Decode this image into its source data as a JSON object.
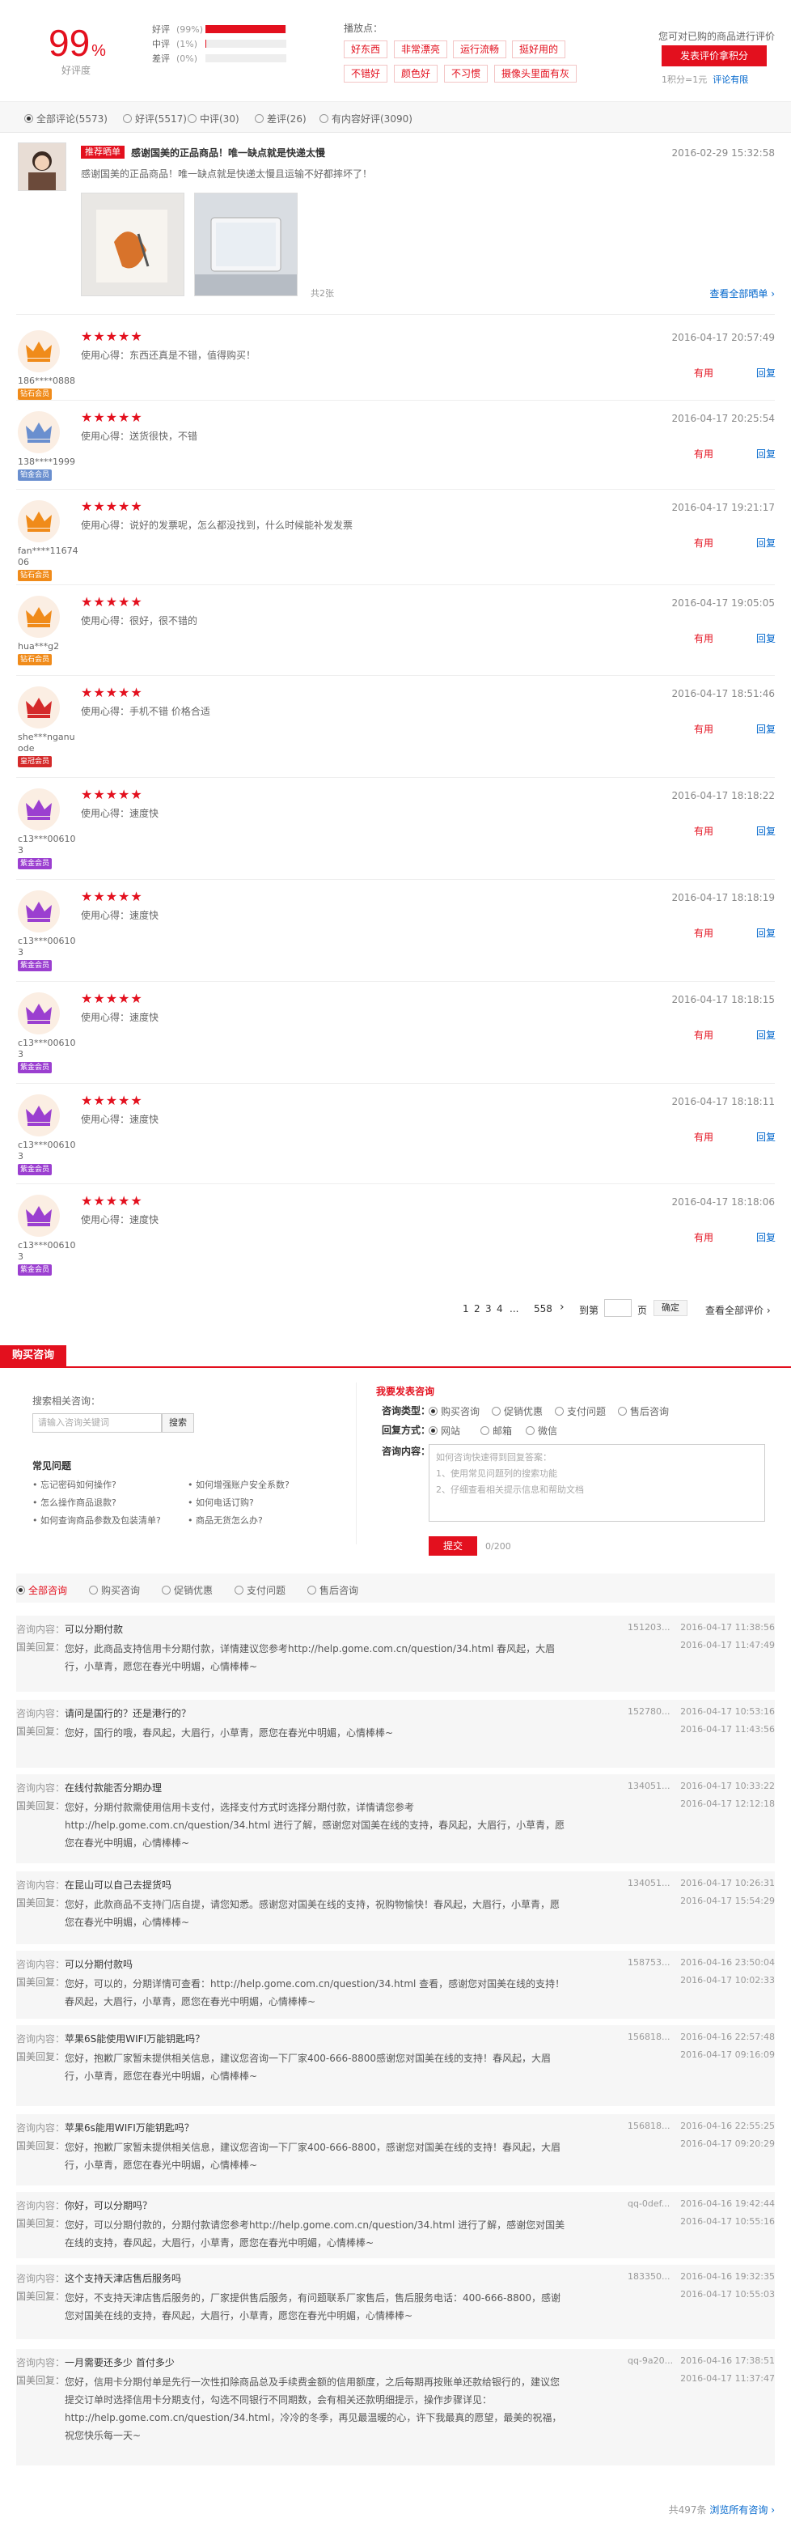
{
  "summary": {
    "good_rate": "99",
    "good_rate_unit": "%",
    "good_rate_label": "好评度",
    "ratings": [
      {
        "label": "好评",
        "percent_text": "(99%)",
        "value": 0.99
      },
      {
        "label": "中评",
        "percent_text": "(1%)",
        "value": 0.01
      },
      {
        "label": "差评",
        "percent_text": "(0%)",
        "value": 0.0
      }
    ],
    "tags_title": "播放点：",
    "tags": [
      "好东西",
      "非常漂亮",
      "运行流畅",
      "挺好用的",
      "不错好",
      "颜色好",
      "不习惯",
      "摄像头里面有灰"
    ],
    "right_text": "您可对已购的商品进行评价",
    "review_button": "发表评价拿积分",
    "points_note": "1积分=1元",
    "points_link": "评论有限"
  },
  "filters": [
    {
      "label": "全部评论(5573)",
      "checked": true
    },
    {
      "label": "好评(5517)",
      "checked": false
    },
    {
      "label": "中评(30)",
      "checked": false
    },
    {
      "label": "差评(26)",
      "checked": false
    },
    {
      "label": "有内容好评(3090)",
      "checked": false
    }
  ],
  "featured": {
    "badge": "推荐晒单",
    "title": "感谢国美的正品商品！唯一缺点就是快递太慢",
    "text": "感谢国美的正品商品！唯一缺点就是快递太慢且运输不好都摔坏了！",
    "date": "2016-02-29 15:32:58",
    "photo_count": "共2张",
    "view_all": "查看全部晒单 ›"
  },
  "reviews": [
    {
      "user": "186****0888",
      "level": "钻石会员",
      "stars": "★★★★★",
      "text": "使用心得：东西还真是不错，值得购买！",
      "date": "2016-04-17 20:57:49"
    },
    {
      "user": "138****1999",
      "level": "铂金会员",
      "stars": "★★★★★",
      "text": "使用心得：送货很快，不错",
      "date": "2016-04-17 20:25:54"
    },
    {
      "user": "fan****11674 06",
      "level": "钻石会员",
      "stars": "★★★★★",
      "text": "使用心得：说好的发票呢，怎么都没找到，什么时候能补发发票",
      "date": "2016-04-17 19:21:17"
    },
    {
      "user": "hua***g2",
      "level": "钻石会员",
      "stars": "★★★★★",
      "text": "使用心得：很好，很不错的",
      "date": "2016-04-17 19:05:05"
    },
    {
      "user": "she***nganu ode",
      "level": "皇冠会员",
      "stars": "★★★★★",
      "text": "使用心得：手机不错 价格合适",
      "date": "2016-04-17 18:51:46"
    },
    {
      "user": "c13***00610 3",
      "level": "紫金会员",
      "stars": "★★★★★",
      "text": "使用心得：速度快",
      "date": "2016-04-17 18:18:22"
    },
    {
      "user": "c13***00610 3",
      "level": "紫金会员",
      "stars": "★★★★★",
      "text": "使用心得：速度快",
      "date": "2016-04-17 18:18:19"
    },
    {
      "user": "c13***00610 3",
      "level": "紫金会员",
      "stars": "★★★★★",
      "text": "使用心得：速度快",
      "date": "2016-04-17 18:18:15"
    },
    {
      "user": "c13***00610 3",
      "level": "紫金会员",
      "stars": "★★★★★",
      "text": "使用心得：速度快",
      "date": "2016-04-17 18:18:11"
    },
    {
      "user": "c13***00610 3",
      "level": "紫金会员",
      "stars": "★★★★★",
      "text": "使用心得：速度快",
      "date": "2016-04-17 18:18:06"
    }
  ],
  "review_actions": {
    "helpful": "有用",
    "reply": "回复"
  },
  "pager": {
    "pages": [
      "1",
      "2",
      "3",
      "4",
      "...",
      "558"
    ],
    "next": "›",
    "goto_label": "到第",
    "page_unit": "页",
    "confirm": "确定",
    "view_all": "查看全部评价 ›"
  },
  "consult": {
    "tab": "购买咨询",
    "search_label": "搜索相关咨询：",
    "search_placeholder": "请输入咨询关键词",
    "search_button": "搜索",
    "faq_title": "常见问题",
    "faq": [
      "忘记密码如何操作?",
      "如何增强账户安全系数?",
      "怎么操作商品退款?",
      "如何电话订购?",
      "如何查询商品参数及包装清单?",
      "商品无货怎么办?"
    ],
    "ask_title": "我要发表咨询",
    "type_label": "咨询类型：",
    "types": [
      "购买咨询",
      "促销优惠",
      "支付问题",
      "售后咨询"
    ],
    "reply_label": "回复方式：",
    "reply_ways": [
      "网站",
      "邮箱",
      "微信"
    ],
    "content_label": "咨询内容：",
    "content_placeholder": "如何咨询快速得到回复答案：",
    "content_hints": [
      "1、使用常见问题列的搜索功能",
      "2、仔细查看相关提示信息和帮助文档"
    ],
    "submit": "提交",
    "counter": "0/200",
    "filter_tabs": [
      "全部咨询",
      "购买咨询",
      "促销优惠",
      "支付问题",
      "售后咨询"
    ],
    "q_label": "咨询内容：",
    "a_label": "国美回复：",
    "items": [
      {
        "q": "可以分期付款",
        "a": "您好，此商品支持信用卡分期付款，详情建议您参考http://help.gome.com.cn/question/34.html 春风起，大眉行，小草青，愿您在春光中明媚，心情棒棒~",
        "user": "151203...",
        "qdate": "2016-04-17 11:38:56",
        "adate": "2016-04-17 11:47:49"
      },
      {
        "q": "请问是国行的？还是港行的？",
        "a": "您好，国行的哦，春风起，大眉行，小草青，愿您在春光中明媚，心情棒棒~",
        "user": "152780...",
        "qdate": "2016-04-17 10:53:16",
        "adate": "2016-04-17 11:43:56"
      },
      {
        "q": "在线付款能否分期办理",
        "a": "您好，分期付款需使用信用卡支付，选择支付方式时选择分期付款，详情请您参考http://help.gome.com.cn/question/34.html 进行了解，感谢您对国美在线的支持，春风起，大眉行，小草青，愿您在春光中明媚，心情棒棒~",
        "user": "134051...",
        "qdate": "2016-04-17 10:33:22",
        "adate": "2016-04-17 12:12:18"
      },
      {
        "q": "在昆山可以自己去提货吗",
        "a": "您好，此款商品不支持门店自提，请您知悉。感谢您对国美在线的支持，祝购物愉快！春风起，大眉行，小草青，愿您在春光中明媚，心情棒棒~",
        "user": "134051...",
        "qdate": "2016-04-17 10:26:31",
        "adate": "2016-04-17 15:54:29"
      },
      {
        "q": "可以分期付款吗",
        "a": "您好，可以的，分期详情可查看：http://help.gome.com.cn/question/34.html 查看，感谢您对国美在线的支持！春风起，大眉行，小草青，愿您在春光中明媚，心情棒棒~",
        "user": "158753...",
        "qdate": "2016-04-16 23:50:04",
        "adate": "2016-04-17 10:02:33"
      },
      {
        "q": "苹果6S能使用WIFI万能钥匙吗？",
        "a": "您好，抱歉厂家暂未提供相关信息，建议您咨询一下厂家400-666-8800感谢您对国美在线的支持！春风起，大眉行，小草青，愿您在春光中明媚，心情棒棒~",
        "user": "156818...",
        "qdate": "2016-04-16 22:57:48",
        "adate": "2016-04-17 09:16:09"
      },
      {
        "q": "苹果6s能用WIFI万能钥匙吗？",
        "a": "您好，抱歉厂家暂未提供相关信息，建议您咨询一下厂家400-666-8800，感谢您对国美在线的支持！春风起，大眉行，小草青，愿您在春光中明媚，心情棒棒~",
        "user": "156818...",
        "qdate": "2016-04-16 22:55:25",
        "adate": "2016-04-17 09:20:29"
      },
      {
        "q": "你好，可以分期吗？",
        "a": "您好，可以分期付款的，分期付款请您参考http://help.gome.com.cn/question/34.html 进行了解，感谢您对国美在线的支持，春风起，大眉行，小草青，愿您在春光中明媚，心情棒棒~",
        "user": "qq-0def...",
        "qdate": "2016-04-16 19:42:44",
        "adate": "2016-04-17 10:55:16"
      },
      {
        "q": "这个支持天津店售后服务吗",
        "a": "您好，不支持天津店售后服务的，厂家提供售后服务，有问题联系厂家售后，售后服务电话：400-666-8800，感谢您对国美在线的支持，春风起，大眉行，小草青，愿您在春光中明媚，心情棒棒~",
        "user": "183350...",
        "qdate": "2016-04-16 19:32:35",
        "adate": "2016-04-17 10:55:03"
      },
      {
        "q": "一月需要还多少 首付多少",
        "a": "您好，信用卡分期付单是先行一次性扣除商品总及手续费金额的信用额度，之后每期再按账单还款给银行的，建议您提交订单时选择信用卡分期支付，勾选不同银行不同期数，会有相关还款明细提示，操作步骤详见：http://help.gome.com.cn/question/34.html，冷冷的冬季，再见最温暖的心，许下我最真的愿望，最美的祝福，祝您快乐每一天~",
        "user": "qq-9a20...",
        "qdate": "2016-04-16 17:38:51",
        "adate": "2016-04-17 11:37:47"
      }
    ],
    "footer_count": "共497条",
    "footer_link": "浏览所有咨询 ›"
  }
}
